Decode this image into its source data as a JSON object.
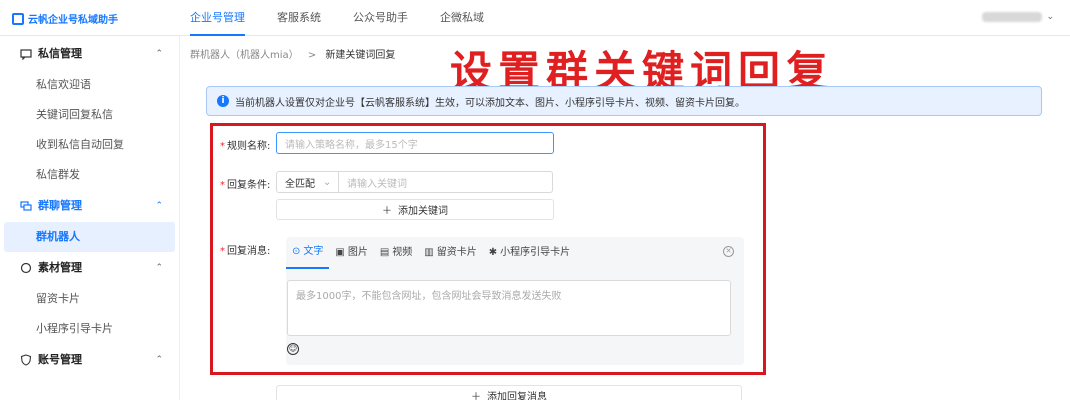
{
  "app": {
    "name": "云帆企业号私域助手"
  },
  "topnav": [
    "企业号管理",
    "客服系统",
    "公众号助手",
    "企微私域"
  ],
  "sidebar": {
    "group1": {
      "title": "私信管理",
      "items": [
        "私信欢迎语",
        "关键词回复私信",
        "收到私信自动回复",
        "私信群发"
      ]
    },
    "group2": {
      "title": "群聊管理",
      "items": [
        "群机器人"
      ]
    },
    "group3": {
      "title": "素材管理",
      "items": [
        "留资卡片",
        "小程序引导卡片"
      ]
    },
    "group4": {
      "title": "账号管理"
    }
  },
  "breadcrumb": {
    "parent": "群机器人（机器人mia）",
    "sep": ">",
    "current": "新建关键词回复"
  },
  "overlay_title": "设置群关键词回复",
  "notice": "当前机器人设置仅对企业号【云帆客服系统】生效，可以添加文本、图片、小程序引导卡片、视频、留资卡片回复。",
  "form": {
    "rule_name_label": "规则名称:",
    "rule_name_placeholder": "请输入策略名称，最多15个字",
    "condition_label": "回复条件:",
    "match_mode": "全匹配",
    "keyword_placeholder": "请输入关键词",
    "add_keyword": "添加关键词",
    "message_label": "回复消息:",
    "tabs": [
      "文字",
      "图片",
      "视频",
      "留资卡片",
      "小程序引导卡片"
    ],
    "textarea_placeholder": "最多1000字，不能包含网址，包含网址会导致消息发送失败",
    "add_message": "添加回复消息"
  },
  "colors": {
    "accent": "#1677ff",
    "highlight_red": "#d9171f"
  }
}
